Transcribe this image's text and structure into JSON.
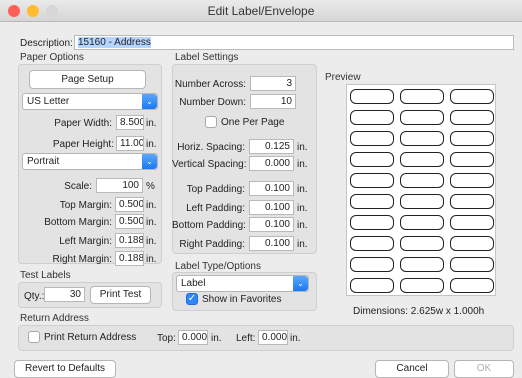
{
  "window": {
    "title": "Edit Label/Envelope",
    "traffic_colors": [
      "#ff5f57",
      "#febc2e",
      "#d6d6d6"
    ]
  },
  "description": {
    "label": "Description:",
    "value": "15160 - Address"
  },
  "paper_options": {
    "section": "Paper Options",
    "page_setup_button": "Page Setup",
    "paper_select": "US Letter",
    "paper_width": {
      "label": "Paper Width:",
      "value": "8.500",
      "unit": "in."
    },
    "paper_height": {
      "label": "Paper Height:",
      "value": "11.000",
      "unit": "in."
    },
    "orientation_select": "Portrait",
    "scale": {
      "label": "Scale:",
      "value": "100",
      "unit": "%"
    },
    "top_margin": {
      "label": "Top Margin:",
      "value": "0.500",
      "unit": "in."
    },
    "bottom_margin": {
      "label": "Bottom Margin:",
      "value": "0.500",
      "unit": "in."
    },
    "left_margin": {
      "label": "Left Margin:",
      "value": "0.188",
      "unit": "in."
    },
    "right_margin": {
      "label": "Right Margin:",
      "value": "0.188",
      "unit": "in."
    }
  },
  "label_settings": {
    "section": "Label Settings",
    "number_across": {
      "label": "Number Across:",
      "value": "3"
    },
    "number_down": {
      "label": "Number Down:",
      "value": "10"
    },
    "one_per_page": {
      "label": "One Per Page",
      "checked": false
    },
    "horiz_spacing": {
      "label": "Horiz. Spacing:",
      "value": "0.125",
      "unit": "in."
    },
    "vertical_spacing": {
      "label": "Vertical Spacing:",
      "value": "0.000",
      "unit": "in."
    },
    "top_padding": {
      "label": "Top Padding:",
      "value": "0.100",
      "unit": "in."
    },
    "left_padding": {
      "label": "Left Padding:",
      "value": "0.100",
      "unit": "in."
    },
    "bottom_padding": {
      "label": "Bottom Padding:",
      "value": "0.100",
      "unit": "in."
    },
    "right_padding": {
      "label": "Right Padding:",
      "value": "0.100",
      "unit": "in."
    }
  },
  "label_type": {
    "section": "Label Type/Options",
    "select": "Label",
    "show_in_favorites": {
      "label": "Show in Favorites",
      "checked": true
    }
  },
  "test_labels": {
    "section": "Test Labels",
    "qty_label": "Qty.:",
    "qty_value": "30",
    "print_test_button": "Print Test"
  },
  "return_address": {
    "section": "Return Address",
    "print_return": {
      "label": "Print Return Address",
      "checked": false
    },
    "top": {
      "label": "Top:",
      "value": "0.000",
      "unit": "in."
    },
    "left": {
      "label": "Left:",
      "value": "0.000",
      "unit": "in."
    }
  },
  "preview": {
    "section": "Preview",
    "dimensions": "Dimensions: 2.625w x 1.000h",
    "columns": 3,
    "rows": 10
  },
  "buttons": {
    "revert": "Revert to Defaults",
    "cancel": "Cancel",
    "ok": "OK"
  }
}
